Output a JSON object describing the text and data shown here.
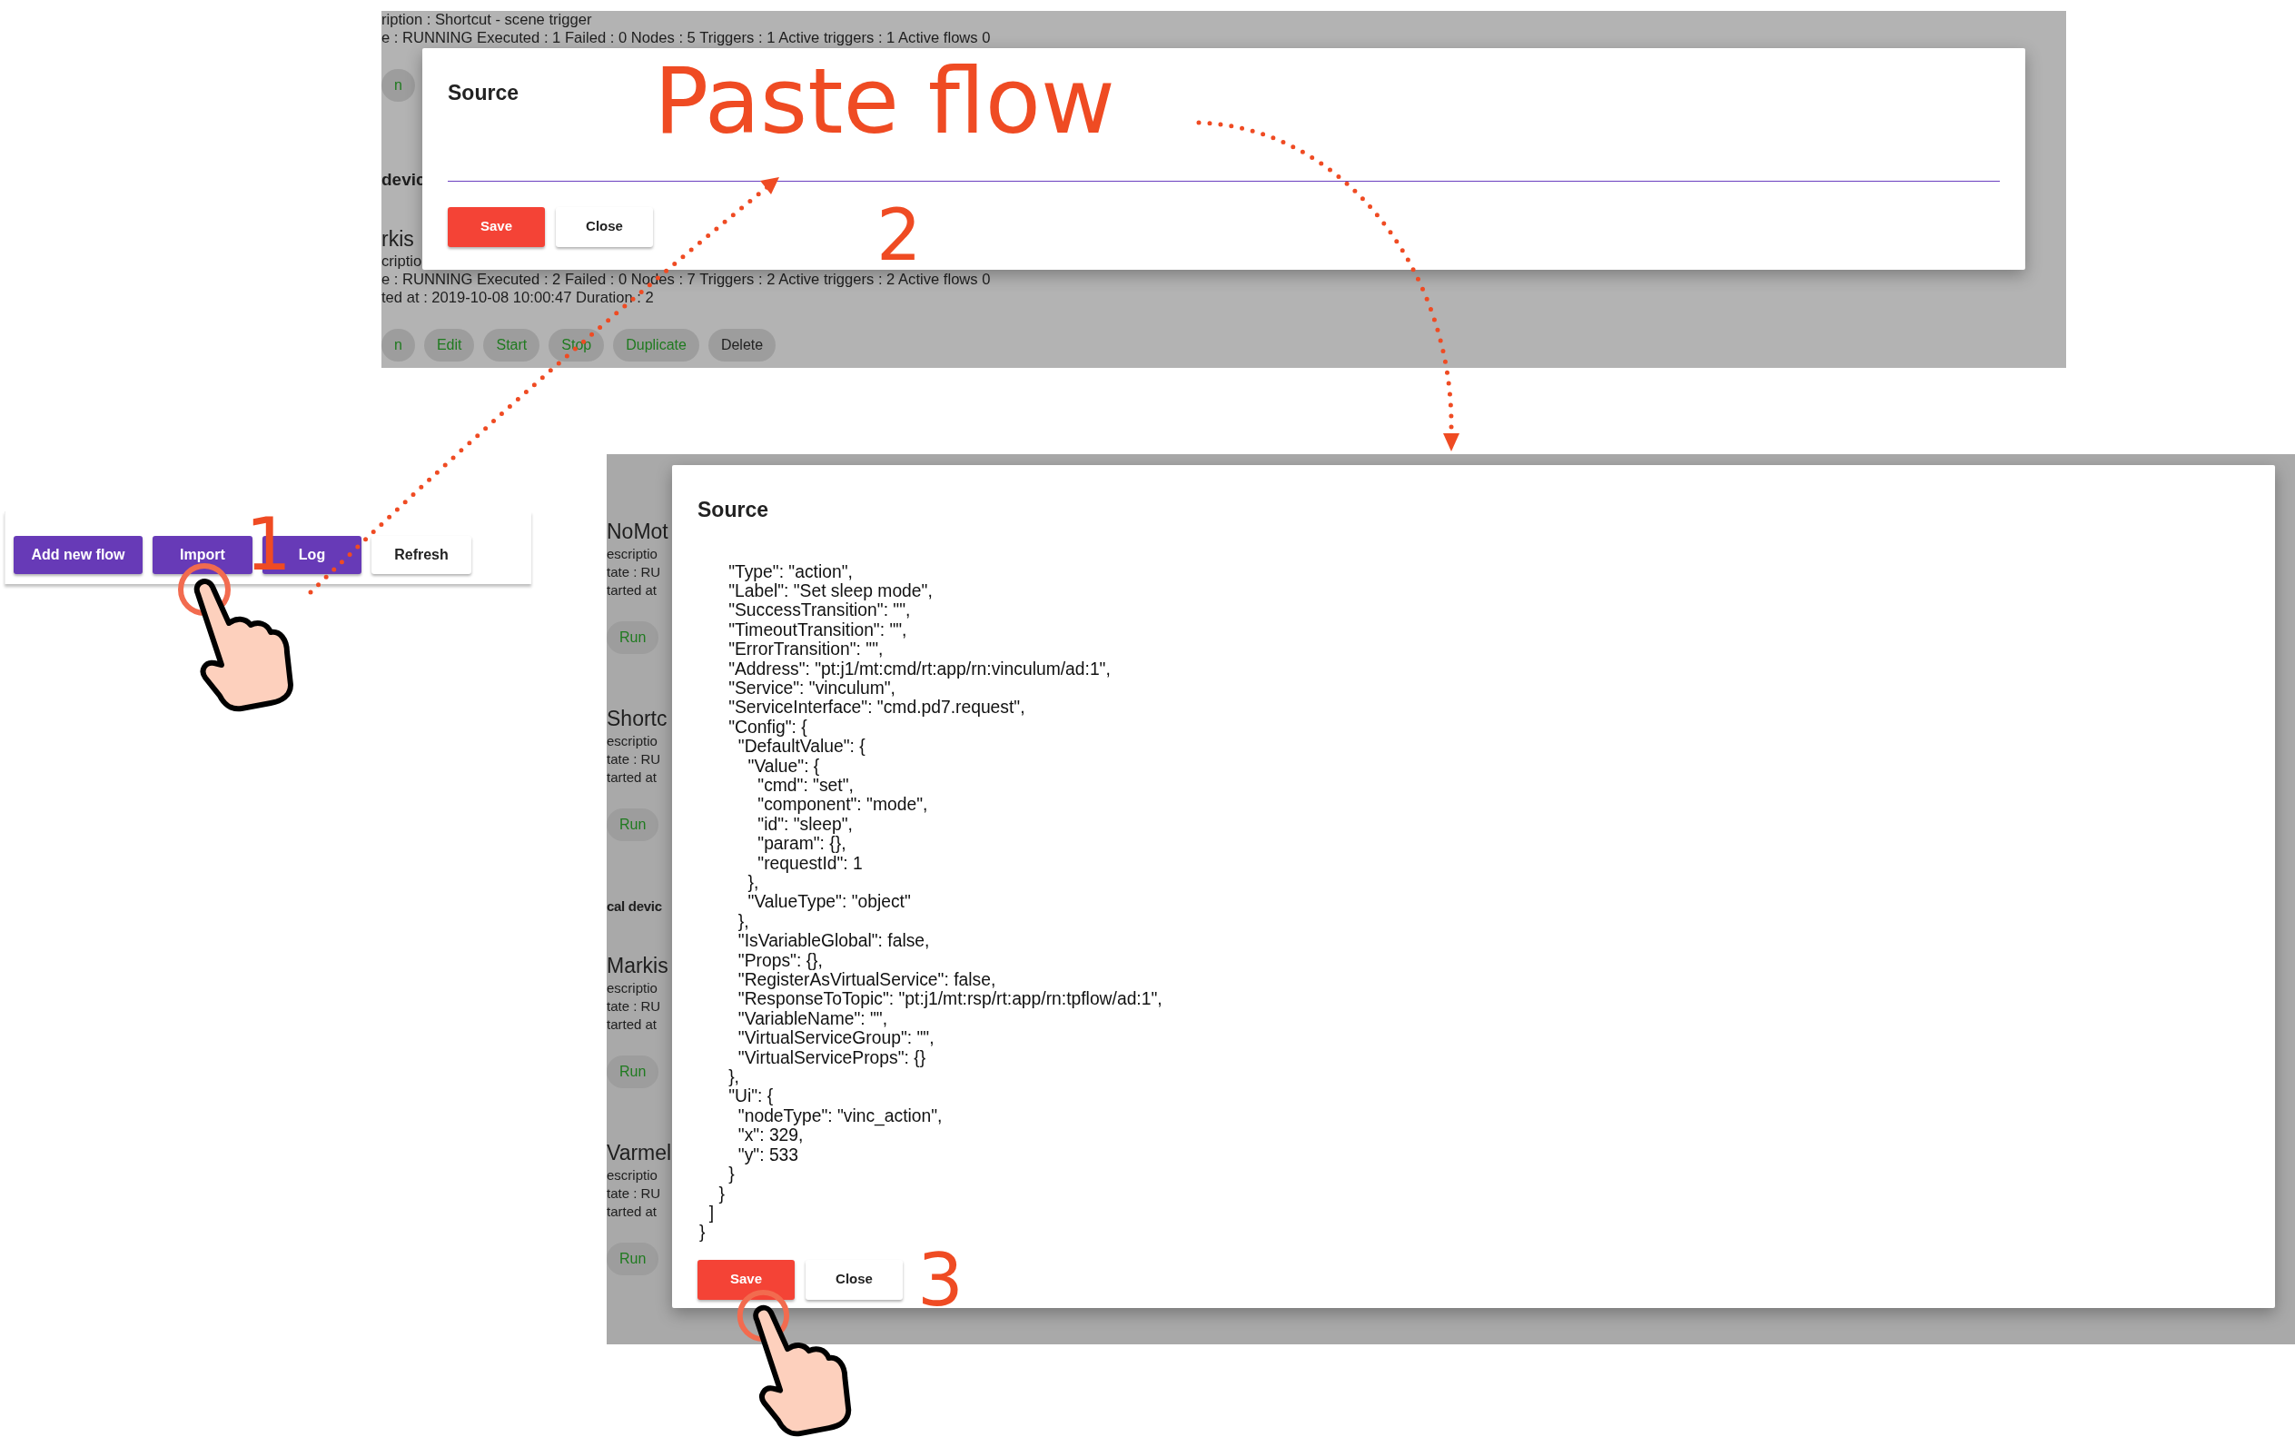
{
  "toolbar": {
    "buttons": [
      {
        "label": "Add new flow",
        "kind": "primary"
      },
      {
        "label": "Import",
        "kind": "primary"
      },
      {
        "label": "Log",
        "kind": "primary"
      },
      {
        "label": "Refresh",
        "kind": "light"
      }
    ]
  },
  "paste_screen": {
    "background": [
      {
        "kind": "detail",
        "text": "ription : Shortcut - scene trigger"
      },
      {
        "kind": "detail",
        "text": "e : RUNNING Executed : 1 Failed : 0 Nodes : 5 Triggers : 1 Active triggers : 1 Active flows 0"
      },
      {
        "kind": "actions",
        "buttons": [
          {
            "label": "n",
            "kind": "positive"
          }
        ]
      },
      {
        "kind": "section",
        "text": "devic"
      },
      {
        "kind": "name",
        "text": "rkis"
      },
      {
        "kind": "detail",
        "text": "criptio"
      },
      {
        "kind": "detail",
        "text": "e : RUNNING Executed : 2 Failed : 0 Nodes : 7 Triggers : 2 Active triggers : 2 Active flows 0"
      },
      {
        "kind": "detail",
        "text": "ted at : 2019-10-08 10:00:47 Duration : 2"
      },
      {
        "kind": "actions",
        "buttons": [
          {
            "label": "n",
            "kind": "positive"
          },
          {
            "label": "Edit",
            "kind": "positive"
          },
          {
            "label": "Start",
            "kind": "positive"
          },
          {
            "label": "Stop",
            "kind": "positive"
          },
          {
            "label": "Duplicate",
            "kind": "positive"
          },
          {
            "label": "Delete",
            "kind": "neutral"
          }
        ]
      }
    ],
    "dialog": {
      "title": "Source",
      "source_field": {
        "focused": true
      },
      "buttons": [
        {
          "label": "Save",
          "kind": "danger"
        },
        {
          "label": "Close",
          "kind": "light"
        }
      ]
    }
  },
  "save_screen": {
    "background": [
      {
        "kind": "name",
        "text": "NoMot"
      },
      {
        "kind": "detail",
        "text": "escriptio"
      },
      {
        "kind": "detail",
        "text": "tate : RU"
      },
      {
        "kind": "detail",
        "text": "tarted at"
      },
      {
        "kind": "actions",
        "buttons": [
          {
            "label": "Run",
            "kind": "positive"
          }
        ]
      },
      {
        "kind": "name",
        "text": "Shortc"
      },
      {
        "kind": "detail",
        "text": "escriptio"
      },
      {
        "kind": "detail",
        "text": "tate : RU"
      },
      {
        "kind": "detail",
        "text": "tarted at"
      },
      {
        "kind": "actions",
        "buttons": [
          {
            "label": "Run",
            "kind": "positive"
          }
        ]
      },
      {
        "kind": "section",
        "text": "cal devic"
      },
      {
        "kind": "name",
        "text": "Markis"
      },
      {
        "kind": "detail",
        "text": "escriptio"
      },
      {
        "kind": "detail",
        "text": "tate : RU"
      },
      {
        "kind": "detail",
        "text": "tarted at"
      },
      {
        "kind": "actions",
        "buttons": [
          {
            "label": "Run",
            "kind": "positive"
          }
        ]
      },
      {
        "kind": "name",
        "text": "Varmel"
      },
      {
        "kind": "detail",
        "text": "escriptio"
      },
      {
        "kind": "detail",
        "text": "tate : RU"
      },
      {
        "kind": "detail",
        "text": "tarted at"
      },
      {
        "kind": "actions",
        "buttons": [
          {
            "label": "Run",
            "kind": "positive"
          }
        ]
      }
    ],
    "dialog": {
      "title": "Source",
      "source_field": {
        "value": "      \"Type\": \"action\",\n      \"Label\": \"Set sleep mode\",\n      \"SuccessTransition\": \"\",\n      \"TimeoutTransition\": \"\",\n      \"ErrorTransition\": \"\",\n      \"Address\": \"pt:j1/mt:cmd/rt:app/rn:vinculum/ad:1\",\n      \"Service\": \"vinculum\",\n      \"ServiceInterface\": \"cmd.pd7.request\",\n      \"Config\": {\n        \"DefaultValue\": {\n          \"Value\": {\n            \"cmd\": \"set\",\n            \"component\": \"mode\",\n            \"id\": \"sleep\",\n            \"param\": {},\n            \"requestId\": 1\n          },\n          \"ValueType\": \"object\"\n        },\n        \"IsVariableGlobal\": false,\n        \"Props\": {},\n        \"RegisterAsVirtualService\": false,\n        \"ResponseToTopic\": \"pt:j1/mt:rsp/rt:app/rn:tpflow/ad:1\",\n        \"VariableName\": \"\",\n        \"VirtualServiceGroup\": \"\",\n        \"VirtualServiceProps\": {}\n      },\n      \"Ui\": {\n        \"nodeType\": \"vinc_action\",\n        \"x\": 329,\n        \"y\": 533\n      }\n    }\n  ]\n}"
      },
      "buttons": [
        {
          "label": "Save",
          "kind": "danger"
        },
        {
          "label": "Close",
          "kind": "light"
        }
      ]
    }
  },
  "annotations": {
    "step_1": "1",
    "headline": "Paste flow",
    "step_2": "2",
    "step_3": "3"
  }
}
